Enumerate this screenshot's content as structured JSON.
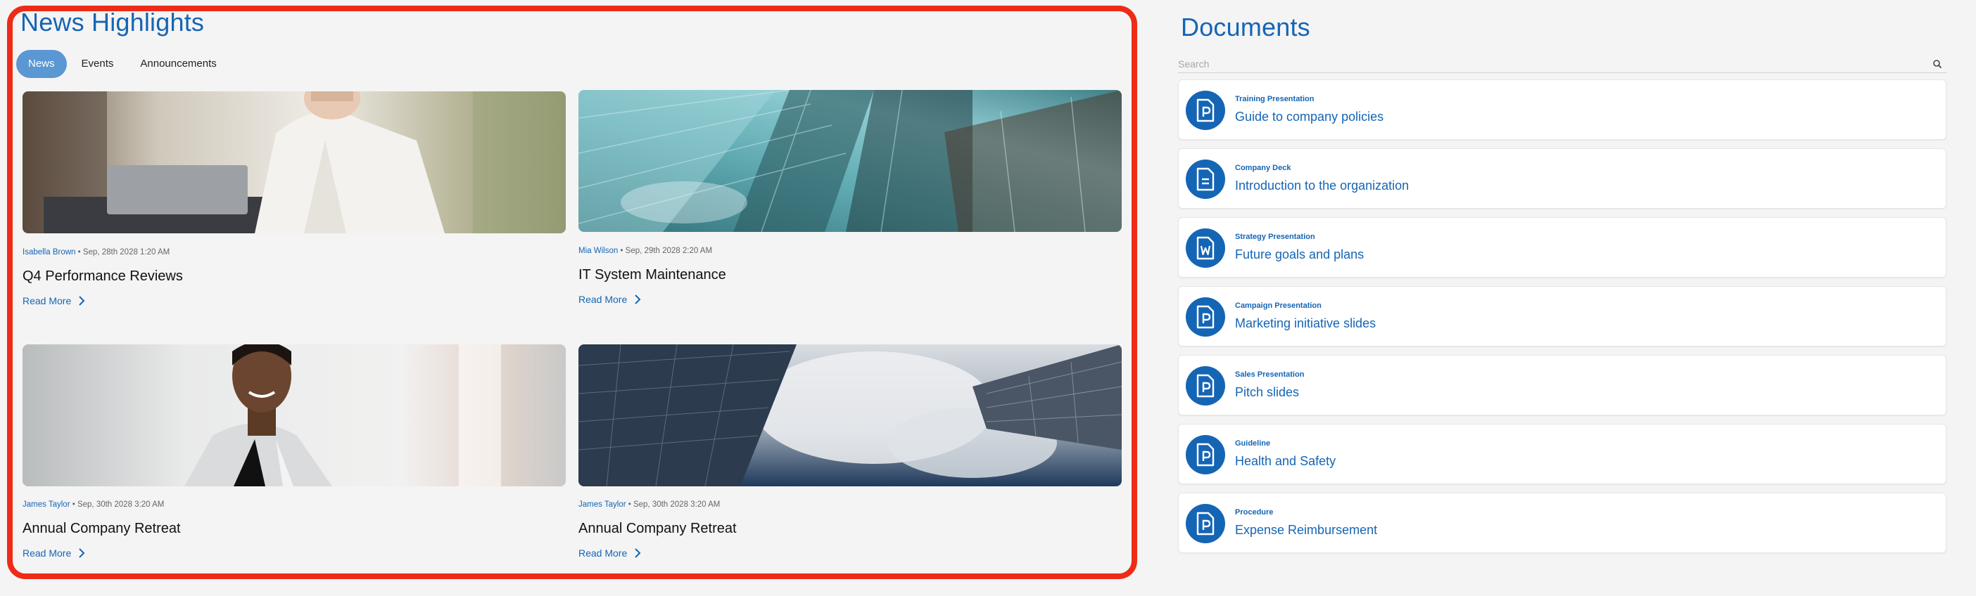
{
  "news": {
    "title": "News Highlights",
    "tabs": [
      {
        "label": "News",
        "active": true
      },
      {
        "label": "Events",
        "active": false
      },
      {
        "label": "Announcements",
        "active": false
      }
    ],
    "cards": [
      {
        "author": "Isabella Brown",
        "date": " • Sep, 28th 2028 1:20 AM",
        "headline": "Q4 Performance Reviews",
        "read_more": "Read More",
        "image": "woman-at-laptop-photo"
      },
      {
        "author": "Mia Wilson",
        "date": " • Sep, 29th 2028 2:20 AM",
        "headline": "IT System Maintenance",
        "read_more": "Read More",
        "image": "glass-skyscraper-photo"
      },
      {
        "author": "James Taylor",
        "date": " • Sep, 30th 2028 3:20 AM",
        "headline": "Annual Company Retreat",
        "read_more": "Read More",
        "image": "smiling-woman-photo"
      },
      {
        "author": "James Taylor",
        "date": " • Sep, 30th 2028 3:20 AM",
        "headline": "Annual Company Retreat",
        "read_more": "Read More",
        "image": "towers-and-clouds-photo"
      }
    ]
  },
  "documents": {
    "title": "Documents",
    "search_placeholder": "Search",
    "items": [
      {
        "category": "Training Presentation",
        "title": "Guide to company policies",
        "icon": "powerpoint-file-icon"
      },
      {
        "category": "Company Deck",
        "title": "Introduction to the organization",
        "icon": "text-file-icon"
      },
      {
        "category": "Strategy Presentation",
        "title": "Future goals and plans",
        "icon": "word-file-icon"
      },
      {
        "category": "Campaign Presentation",
        "title": "Marketing initiative slides",
        "icon": "powerpoint-file-icon"
      },
      {
        "category": "Sales Presentation",
        "title": "Pitch slides",
        "icon": "powerpoint-file-icon"
      },
      {
        "category": "Guideline",
        "title": "Health and Safety",
        "icon": "powerpoint-file-icon"
      },
      {
        "category": "Procedure",
        "title": "Expense Reimbursement",
        "icon": "powerpoint-file-icon"
      }
    ]
  },
  "colors": {
    "accent": "#1565b5",
    "highlight_border": "#ee2b17",
    "active_tab": "#5b97d3"
  }
}
